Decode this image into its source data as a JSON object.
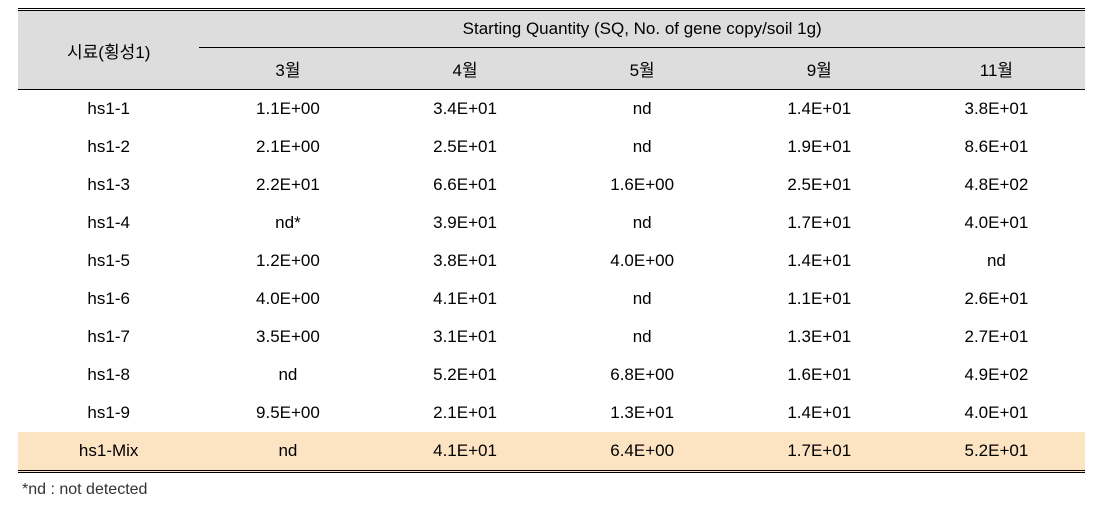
{
  "header": {
    "sample_label": "시료(횡성1)",
    "sq_label": "Starting Quantity (SQ, No. of gene copy/soil 1g)",
    "months": [
      "3월",
      "4월",
      "5월",
      "9월",
      "11월"
    ]
  },
  "rows": [
    {
      "sample": "hs1-1",
      "v": [
        "1.1E+00",
        "3.4E+01",
        "nd",
        "1.4E+01",
        "3.8E+01"
      ]
    },
    {
      "sample": "hs1-2",
      "v": [
        "2.1E+00",
        "2.5E+01",
        "nd",
        "1.9E+01",
        "8.6E+01"
      ]
    },
    {
      "sample": "hs1-3",
      "v": [
        "2.2E+01",
        "6.6E+01",
        "1.6E+00",
        "2.5E+01",
        "4.8E+02"
      ]
    },
    {
      "sample": "hs1-4",
      "v": [
        "nd*",
        "3.9E+01",
        "nd",
        "1.7E+01",
        "4.0E+01"
      ]
    },
    {
      "sample": "hs1-5",
      "v": [
        "1.2E+00",
        "3.8E+01",
        "4.0E+00",
        "1.4E+01",
        "nd"
      ]
    },
    {
      "sample": "hs1-6",
      "v": [
        "4.0E+00",
        "4.1E+01",
        "nd",
        "1.1E+01",
        "2.6E+01"
      ]
    },
    {
      "sample": "hs1-7",
      "v": [
        "3.5E+00",
        "3.1E+01",
        "nd",
        "1.3E+01",
        "2.7E+01"
      ]
    },
    {
      "sample": "hs1-8",
      "v": [
        "nd",
        "5.2E+01",
        "6.8E+00",
        "1.6E+01",
        "4.9E+02"
      ]
    },
    {
      "sample": "hs1-9",
      "v": [
        "9.5E+00",
        "2.1E+01",
        "1.3E+01",
        "1.4E+01",
        "4.0E+01"
      ]
    },
    {
      "sample": "hs1-Mix",
      "v": [
        "nd",
        "4.1E+01",
        "6.4E+00",
        "1.7E+01",
        "5.2E+01"
      ]
    }
  ],
  "footnote": "*nd : not detected"
}
